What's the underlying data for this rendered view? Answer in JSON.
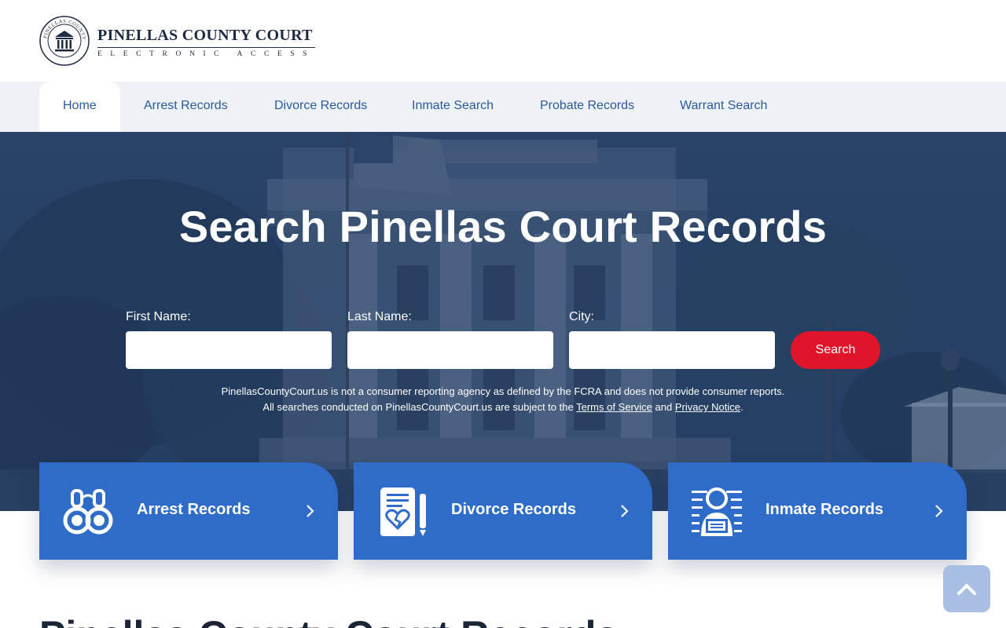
{
  "header": {
    "logo_title": "PINELLAS COUNTY COURT",
    "logo_subtitle": "ELECTRONIC ACCESS",
    "seal_text": "PINELLAS COUNTY COURT"
  },
  "nav": {
    "items": [
      {
        "label": "Home",
        "active": true
      },
      {
        "label": "Arrest Records"
      },
      {
        "label": "Divorce Records"
      },
      {
        "label": "Inmate Search"
      },
      {
        "label": "Probate Records"
      },
      {
        "label": "Warrant Search"
      }
    ]
  },
  "hero": {
    "title": "Search Pinellas Court Records",
    "fields": [
      {
        "label": "First Name:",
        "value": "",
        "placeholder": ""
      },
      {
        "label": "Last Name:",
        "value": "",
        "placeholder": ""
      },
      {
        "label": "City:",
        "value": "",
        "placeholder": ""
      }
    ],
    "search_label": "Search",
    "disclaimer_line1": "PinellasCountyCourt.us is not a consumer reporting agency as defined by the FCRA and does not provide consumer reports.",
    "disclaimer_line2_pre": "All searches conducted on PinellasCountyCourt.us are subject to the",
    "terms_link": "Terms of Service",
    "disclaimer_and": "and",
    "privacy_link": "Privacy Notice",
    "disclaimer_end": "."
  },
  "cards": [
    {
      "label": "Arrest Records",
      "icon": "handcuffs-icon"
    },
    {
      "label": "Divorce Records",
      "icon": "divorce-document-icon"
    },
    {
      "label": "Inmate Records",
      "icon": "inmate-icon"
    }
  ],
  "section": {
    "heading": "Pinellas County Court Records"
  },
  "colors": {
    "brand_blue": "#2f6cca",
    "nav_link": "#2a5a9e",
    "search_red": "#e11529",
    "logo_navy": "#1d2a44"
  }
}
